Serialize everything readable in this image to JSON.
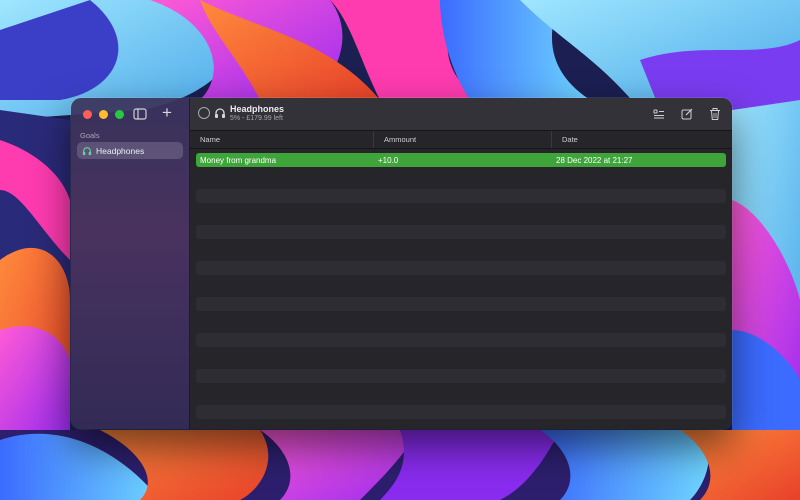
{
  "sidebar": {
    "section_label": "Goals",
    "items": [
      {
        "label": "Headphones",
        "icon": "headphones-icon",
        "selected": true
      }
    ]
  },
  "toolbar": {
    "title": "Headphones",
    "subtitle": "5% - £179.99 left",
    "buttons": [
      "list-icon",
      "edit-icon",
      "trash-icon"
    ]
  },
  "table": {
    "columns": [
      "Name",
      "Ammount",
      "Date"
    ],
    "rows": [
      {
        "name": "Money from grandma",
        "amount": "+10.0",
        "date": "28 Dec 2022 at 21:27",
        "selected": true
      }
    ],
    "empty_rows": 12
  },
  "colors": {
    "selection": "#3fa43a",
    "accent_icon": "#5fd1a3"
  }
}
